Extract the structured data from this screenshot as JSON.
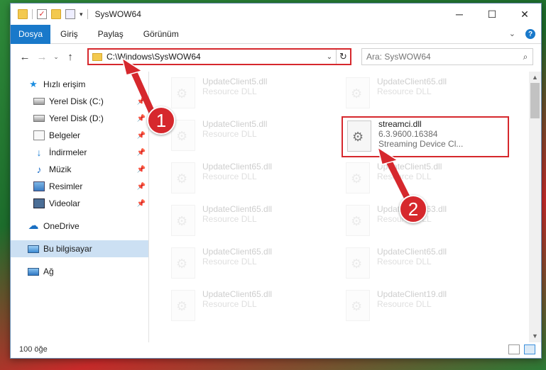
{
  "window": {
    "title": "SysWOW64",
    "controls": {
      "minimize": "─",
      "maximize": "☐",
      "close": "✕"
    }
  },
  "ribbon": {
    "file_tab": "Dosya",
    "tabs": [
      "Giriş",
      "Paylaş",
      "Görünüm"
    ],
    "expand": "⌄",
    "help": "?"
  },
  "nav": {
    "back": "←",
    "forward": "→",
    "recent": "⌄",
    "up": "↑",
    "address": "C:\\Windows\\SysWOW64",
    "address_drop": "⌄",
    "refresh": "↻",
    "search_placeholder": "Ara: SysWOW64",
    "search_icon": "⌕"
  },
  "sidebar": {
    "items": [
      {
        "label": "Hızlı erişim",
        "icon": "star-icon"
      },
      {
        "label": "Yerel Disk (C:)",
        "icon": "disk-icon",
        "pinned": true
      },
      {
        "label": "Yerel Disk (D:)",
        "icon": "disk-icon",
        "pinned": true
      },
      {
        "label": "Belgeler",
        "icon": "document-icon",
        "pinned": true
      },
      {
        "label": "İndirmeler",
        "icon": "download-icon",
        "pinned": true
      },
      {
        "label": "Müzik",
        "icon": "music-icon",
        "pinned": true
      },
      {
        "label": "Resimler",
        "icon": "picture-icon",
        "pinned": true
      },
      {
        "label": "Videolar",
        "icon": "video-icon",
        "pinned": true
      },
      {
        "label": "OneDrive",
        "icon": "cloud-icon"
      },
      {
        "label": "Bu bilgisayar",
        "icon": "computer-icon",
        "selected": true
      },
      {
        "label": "Ağ",
        "icon": "network-icon"
      }
    ],
    "pin_glyph": "📌"
  },
  "files": {
    "left": [
      {
        "name": "UpdateClient5.dll",
        "sub": "Resource DLL"
      },
      {
        "name": "UpdateClient5.dll",
        "sub": "Resource DLL"
      },
      {
        "name": "UpdateClient65.dll",
        "sub": "Resource DLL"
      },
      {
        "name": "UpdateClient65.dll",
        "sub": "Resource DLL"
      },
      {
        "name": "UpdateClient65.dll",
        "sub": "Resource DLL"
      },
      {
        "name": "UpdateClient65.dll",
        "sub": "Resource DLL"
      }
    ],
    "right": [
      {
        "name": "UpdateClient65.dll",
        "sub": "Resource DLL"
      },
      {
        "name": "streamci.dll",
        "sub": "6.3.9600.16384",
        "sub2": "Streaming Device Cl..."
      },
      {
        "name": "UpdateClient5.dll",
        "sub": "Resource DLL"
      },
      {
        "name": "UpdateClient63.dll",
        "sub": "Resource DLL"
      },
      {
        "name": "UpdateClient65.dll",
        "sub": "Resource DLL"
      },
      {
        "name": "UpdateClient19.dll",
        "sub": "Resource DLL"
      }
    ]
  },
  "status": {
    "count": "100 öğe"
  },
  "annotations": {
    "step1": "1",
    "step2": "2",
    "color": "#d6282d"
  }
}
